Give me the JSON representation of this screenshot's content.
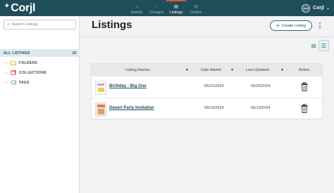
{
  "app": {
    "brand": "Corjl"
  },
  "nav": [
    {
      "label": "Assets",
      "icon": "assets-icon",
      "active": false
    },
    {
      "label": "Designs",
      "icon": "designs-icon",
      "active": false
    },
    {
      "label": "Listings",
      "icon": "listings-icon",
      "active": true
    },
    {
      "label": "Orders",
      "icon": "orders-icon",
      "active": false
    }
  ],
  "user": {
    "name": "Corjl",
    "avatar_text": "corjl"
  },
  "sidebar": {
    "search_placeholder": "Search Listings",
    "all_listings_label": "ALL LISTINGS",
    "all_listings_count": "16",
    "tree": [
      {
        "label": "FOLDERS",
        "icon": "folder-icon"
      },
      {
        "label": "COLLECTIONS",
        "icon": "collections-icon"
      },
      {
        "label": "TAGS",
        "icon": "tag-icon"
      }
    ]
  },
  "main": {
    "title": "Listings",
    "create_button": "Create Listing",
    "table": {
      "headers": {
        "name": "Listing Names",
        "added": "Date Added",
        "updated": "Last Updated",
        "action": "Action"
      },
      "rows": [
        {
          "name": "Birthday - Big One",
          "added": "06/21/2024",
          "updated": "06/26/2024"
        },
        {
          "name": "Desert Party Invitation",
          "added": "06/10/2024",
          "updated": "06/13/2024"
        }
      ]
    }
  },
  "colors": {
    "topbar": "#1f4e5a",
    "accent": "#1f6b78",
    "active_tab": "#e0533d"
  }
}
